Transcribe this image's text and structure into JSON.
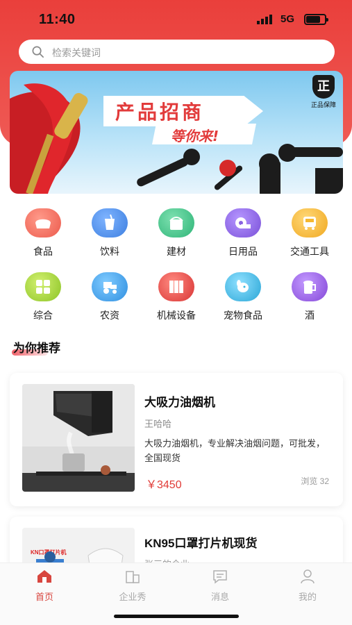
{
  "status_bar": {
    "time": "11:40",
    "network": "5G"
  },
  "search": {
    "placeholder": "检索关键词"
  },
  "banner": {
    "title": "产品招商",
    "subtitle": "等你来!",
    "badge_text": "正",
    "badge_label": "正品保障"
  },
  "categories": [
    {
      "label": "食品",
      "icon": "bread-icon",
      "color": "#f06a5a"
    },
    {
      "label": "饮料",
      "icon": "cup-icon",
      "color": "#4a8ee8"
    },
    {
      "label": "建材",
      "icon": "paint-bucket-icon",
      "color": "#3fc38a"
    },
    {
      "label": "日用品",
      "icon": "tissue-roll-icon",
      "color": "#8a62e0"
    },
    {
      "label": "交通工具",
      "icon": "bus-icon",
      "color": "#f5b830"
    },
    {
      "label": "综合",
      "icon": "grid-icon",
      "color": "#a3d23a"
    },
    {
      "label": "农资",
      "icon": "tractor-icon",
      "color": "#3fa6e8"
    },
    {
      "label": "机械设备",
      "icon": "machine-icon",
      "color": "#e84848"
    },
    {
      "label": "宠物食品",
      "icon": "dog-icon",
      "color": "#35b6e0"
    },
    {
      "label": "酒",
      "icon": "beer-icon",
      "color": "#9a5ee0"
    }
  ],
  "section": {
    "title": "为你推荐"
  },
  "products": [
    {
      "title": "大吸力油烟机",
      "company": "王哈哈",
      "description": "大吸力油烟机，专业解决油烟问题，可批发，全国现货",
      "price": "￥3450",
      "views": "浏览 32"
    },
    {
      "title": "KN95口罩打片机现货",
      "company": "张三的企业",
      "image_label": "KN口罩打片机"
    }
  ],
  "tabbar": [
    {
      "label": "首页",
      "icon": "home-icon",
      "active": true
    },
    {
      "label": "企业秀",
      "icon": "building-icon",
      "active": false
    },
    {
      "label": "消息",
      "icon": "message-icon",
      "active": false
    },
    {
      "label": "我的",
      "icon": "user-icon",
      "active": false
    }
  ],
  "colors": {
    "brand_red": "#ea3f3b",
    "price_red": "#e03a36"
  }
}
